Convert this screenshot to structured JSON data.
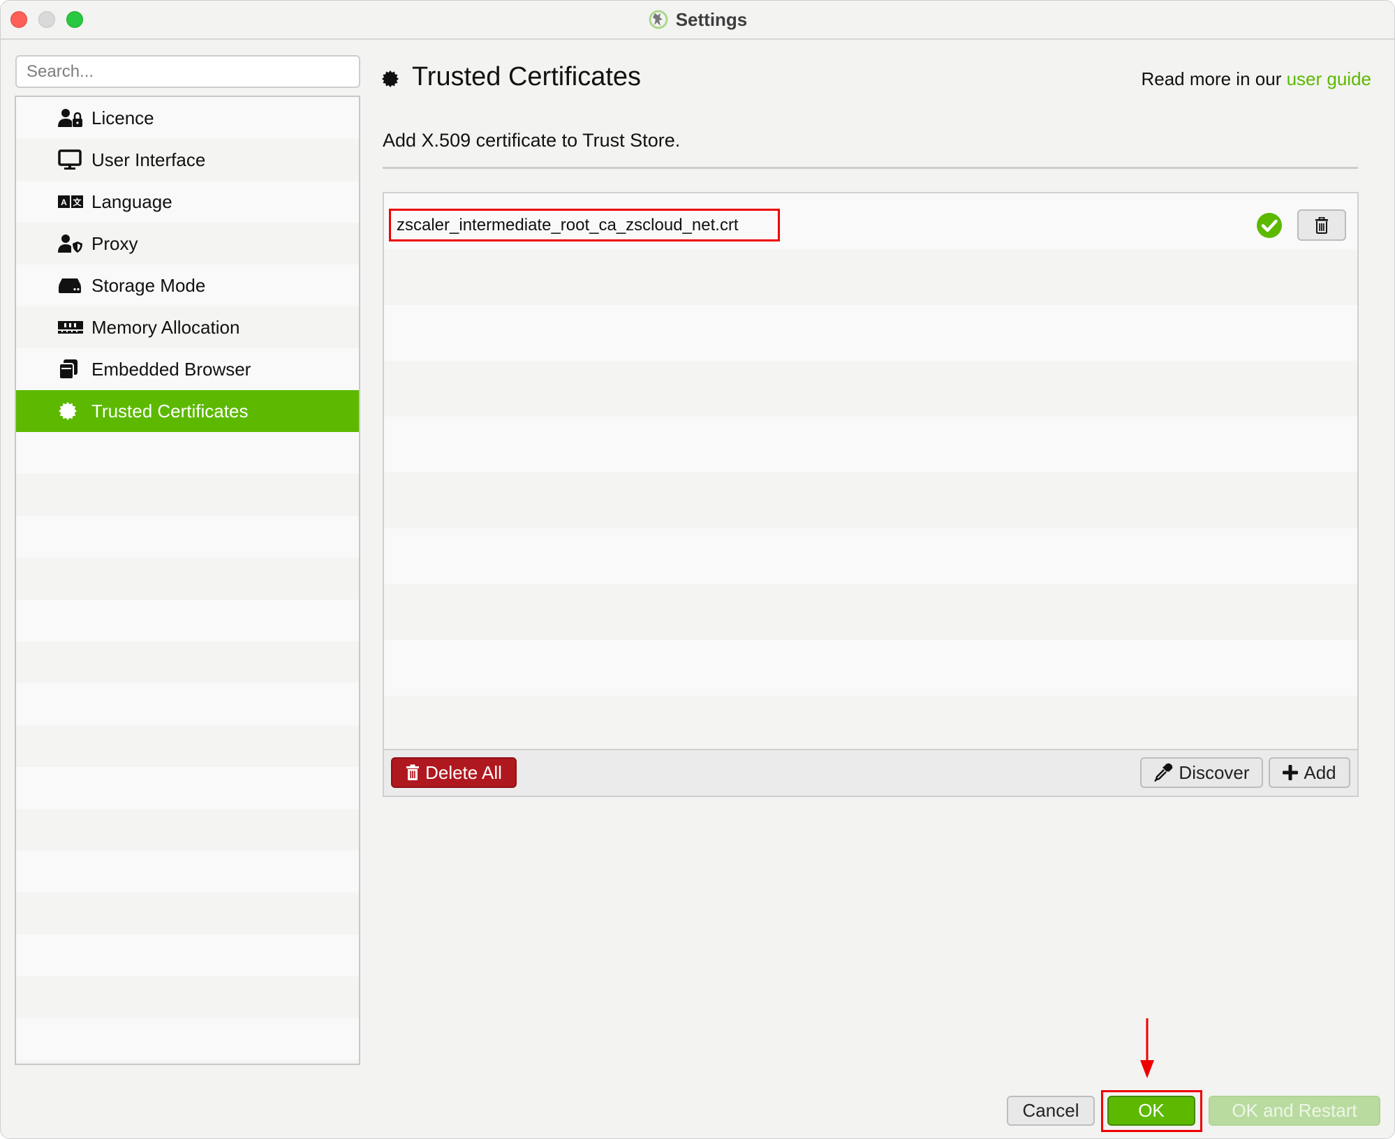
{
  "window": {
    "title": "Settings",
    "app_icon": "frog-logo-icon"
  },
  "search": {
    "placeholder": "Search...",
    "value": ""
  },
  "sidebar": {
    "items": [
      {
        "label": "Licence",
        "icon": "user-lock-icon",
        "active": false
      },
      {
        "label": "User Interface",
        "icon": "monitor-icon",
        "active": false
      },
      {
        "label": "Language",
        "icon": "language-icon",
        "active": false
      },
      {
        "label": "Proxy",
        "icon": "user-shield-icon",
        "active": false
      },
      {
        "label": "Storage Mode",
        "icon": "hard-drive-icon",
        "active": false
      },
      {
        "label": "Memory Allocation",
        "icon": "memory-icon",
        "active": false
      },
      {
        "label": "Embedded Browser",
        "icon": "browser-windows-icon",
        "active": false
      },
      {
        "label": "Trusted Certificates",
        "icon": "certificate-icon",
        "active": true
      }
    ],
    "active_color": "#5cb900"
  },
  "main": {
    "title": "Trusted Certificates",
    "title_icon": "certificate-icon",
    "read_more_prefix": "Read more in our ",
    "read_more_link": "user guide",
    "subtitle": "Add X.509 certificate to Trust Store.",
    "certificates": [
      {
        "name": "zscaler_intermediate_root_ca_zscloud_net.crt",
        "status": "valid",
        "status_icon": "check-circle-icon"
      }
    ],
    "buttons": {
      "delete_all": "Delete All",
      "discover": "Discover",
      "add": "Add"
    }
  },
  "footer": {
    "cancel": "Cancel",
    "ok": "OK",
    "ok_restart": "OK and Restart",
    "ok_restart_enabled": false
  },
  "annotations": {
    "highlight_color": "#ee0000",
    "highlighted": [
      "certificate-name",
      "ok-button"
    ],
    "arrow_target": "ok-button"
  },
  "colors": {
    "accent": "#5cb900",
    "danger": "#b01820",
    "link": "#5cb900"
  }
}
